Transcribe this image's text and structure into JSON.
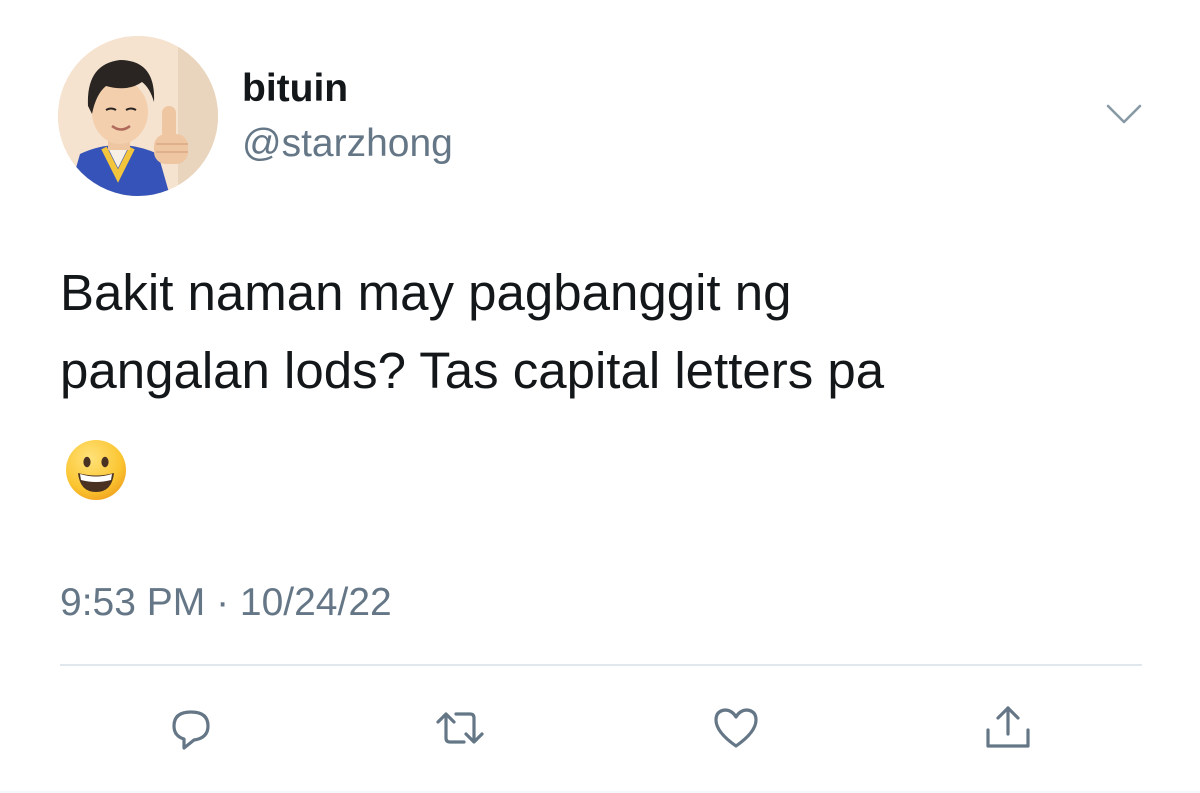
{
  "user": {
    "display_name": "bituin",
    "handle": "@starzhong"
  },
  "tweet": {
    "text_lines": [
      "Bakit naman may pagbanggit ng",
      "pangalan lods? Tas capital letters pa"
    ],
    "emoji": "grinning-face",
    "timestamp": "9:53 PM · 10/24/22"
  },
  "actions": [
    "reply",
    "retweet",
    "like",
    "share"
  ],
  "colors": {
    "text": "#14171a",
    "secondary": "#657786",
    "divider": "#e1e8ed",
    "icon": "#657786"
  }
}
